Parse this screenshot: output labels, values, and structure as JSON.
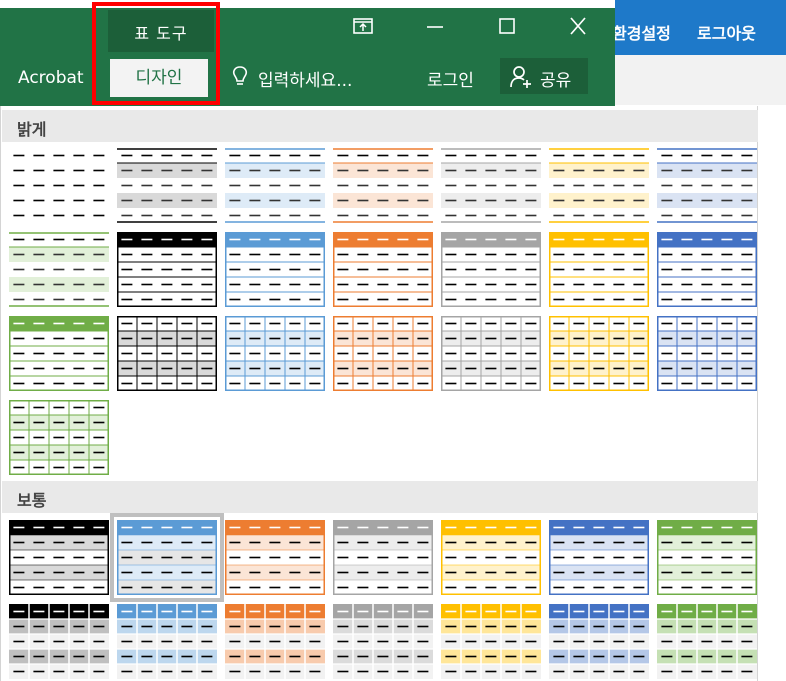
{
  "ribbon": {
    "context_group_label": "표 도구",
    "tabs": [
      {
        "label": "Acrobat"
      },
      {
        "label": "디자인"
      }
    ],
    "tell_me_placeholder": "입력하세요...",
    "login_label": "로그인",
    "share_label": "공유"
  },
  "outer_toolbar": {
    "items": [
      {
        "label": "환경설정"
      },
      {
        "label": "로그아웃"
      }
    ]
  },
  "gallery": {
    "sections": [
      {
        "label": "밝게",
        "styles": [
          {
            "type": "plain",
            "color": "#000000",
            "row_shade": "#ffffff"
          },
          {
            "type": "light-band",
            "color": "#000000",
            "row_shade": "#d9d9d9"
          },
          {
            "type": "light-band",
            "color": "#5b9bd5",
            "row_shade": "#deebf7"
          },
          {
            "type": "light-band",
            "color": "#ed7d31",
            "row_shade": "#fbe5d6"
          },
          {
            "type": "light-band",
            "color": "#a5a5a5",
            "row_shade": "#ededed"
          },
          {
            "type": "light-band",
            "color": "#ffc000",
            "row_shade": "#fff2cc"
          },
          {
            "type": "light-band",
            "color": "#4472c4",
            "row_shade": "#dae3f3"
          },
          {
            "type": "light-band",
            "color": "#70ad47",
            "row_shade": "#e2f0d9"
          },
          {
            "type": "header-box",
            "color": "#000000",
            "row_shade": "#ffffff"
          },
          {
            "type": "header-box",
            "color": "#5b9bd5",
            "row_shade": "#ffffff"
          },
          {
            "type": "header-box",
            "color": "#ed7d31",
            "row_shade": "#ffffff"
          },
          {
            "type": "header-box",
            "color": "#a5a5a5",
            "row_shade": "#ffffff"
          },
          {
            "type": "header-box",
            "color": "#ffc000",
            "row_shade": "#ffffff"
          },
          {
            "type": "header-box",
            "color": "#4472c4",
            "row_shade": "#ffffff"
          },
          {
            "type": "header-box",
            "color": "#70ad47",
            "row_shade": "#ffffff"
          },
          {
            "type": "grid",
            "color": "#000000",
            "row_shade": "#d9d9d9"
          },
          {
            "type": "grid",
            "color": "#5b9bd5",
            "row_shade": "#deebf7"
          },
          {
            "type": "grid",
            "color": "#ed7d31",
            "row_shade": "#fbe5d6"
          },
          {
            "type": "grid",
            "color": "#a5a5a5",
            "row_shade": "#ededed"
          },
          {
            "type": "grid",
            "color": "#ffc000",
            "row_shade": "#fff2cc"
          },
          {
            "type": "grid",
            "color": "#4472c4",
            "row_shade": "#dae3f3"
          },
          {
            "type": "grid",
            "color": "#70ad47",
            "row_shade": "#e2f0d9"
          }
        ]
      },
      {
        "label": "보통",
        "styles": [
          {
            "type": "medium-band",
            "color": "#000000",
            "row_shade": "#d9d9d9",
            "selected": false
          },
          {
            "type": "medium-band",
            "color": "#5b9bd5",
            "row_shade": "#deebf7",
            "selected": true
          },
          {
            "type": "medium-band",
            "color": "#ed7d31",
            "row_shade": "#fbe5d6",
            "selected": false
          },
          {
            "type": "medium-band",
            "color": "#a5a5a5",
            "row_shade": "#ededed",
            "selected": false
          },
          {
            "type": "medium-band",
            "color": "#ffc000",
            "row_shade": "#fff2cc",
            "selected": false
          },
          {
            "type": "medium-band",
            "color": "#4472c4",
            "row_shade": "#dae3f3",
            "selected": false
          },
          {
            "type": "medium-band",
            "color": "#70ad47",
            "row_shade": "#e2f0d9",
            "selected": false
          },
          {
            "type": "medium-grid",
            "color": "#000000",
            "row_shade": "#bfbfbf",
            "selected": false
          },
          {
            "type": "medium-grid",
            "color": "#5b9bd5",
            "row_shade": "#bdd7ee",
            "selected": false
          },
          {
            "type": "medium-grid",
            "color": "#ed7d31",
            "row_shade": "#f8cbad",
            "selected": false
          },
          {
            "type": "medium-grid",
            "color": "#a5a5a5",
            "row_shade": "#dbdbdb",
            "selected": false
          },
          {
            "type": "medium-grid",
            "color": "#ffc000",
            "row_shade": "#ffe699",
            "selected": false
          },
          {
            "type": "medium-grid",
            "color": "#4472c4",
            "row_shade": "#b4c7e7",
            "selected": false
          },
          {
            "type": "medium-grid",
            "color": "#70ad47",
            "row_shade": "#c5e0b4",
            "selected": false
          }
        ]
      }
    ]
  }
}
